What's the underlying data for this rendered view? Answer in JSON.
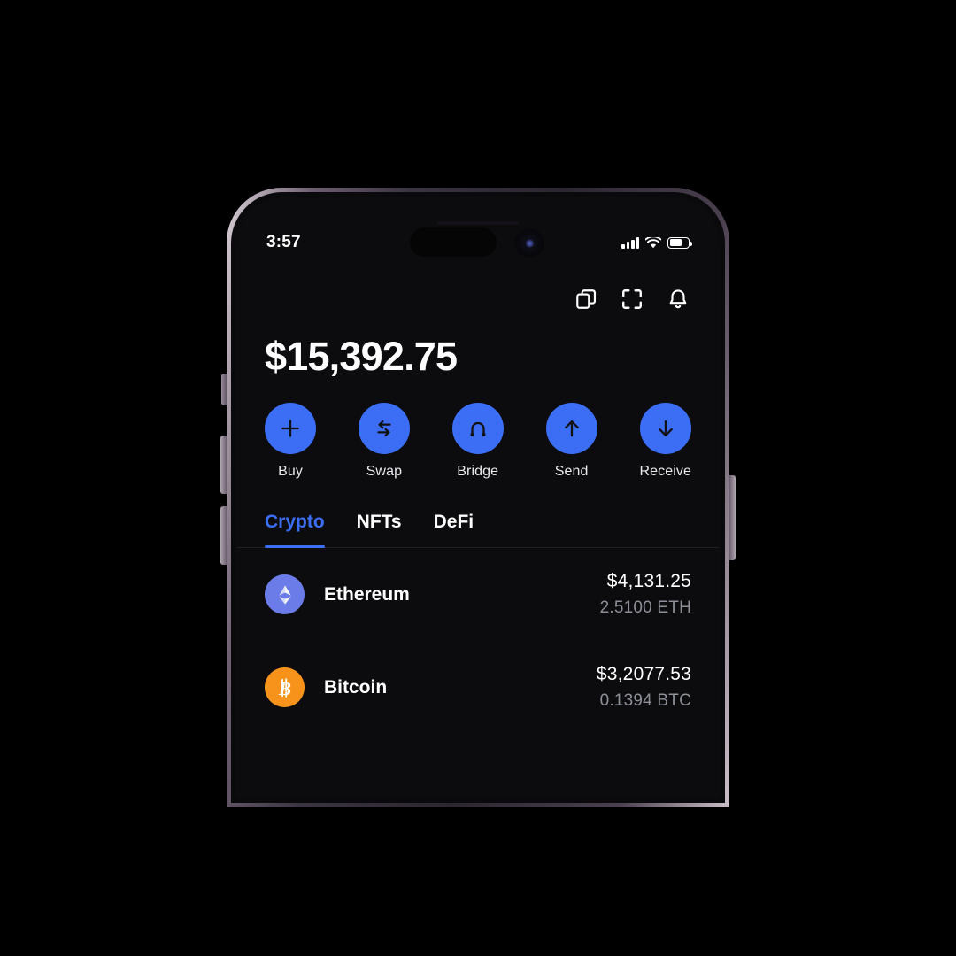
{
  "status_bar": {
    "time": "3:57",
    "signal_icon": "cellular-signal-icon",
    "wifi_icon": "wifi-icon",
    "battery_icon": "battery-icon",
    "battery_level_pct": 70
  },
  "header": {
    "actions": [
      {
        "name": "copy-icon",
        "label": "Copy"
      },
      {
        "name": "scan-icon",
        "label": "Scan"
      },
      {
        "name": "bell-icon",
        "label": "Notifications"
      }
    ]
  },
  "wallet": {
    "balance": "$15,392.75"
  },
  "quick_actions": [
    {
      "label": "Buy",
      "icon": "plus-icon"
    },
    {
      "label": "Swap",
      "icon": "swap-arrows-icon"
    },
    {
      "label": "Bridge",
      "icon": "bridge-icon"
    },
    {
      "label": "Send",
      "icon": "arrow-up-icon"
    },
    {
      "label": "Receive",
      "icon": "arrow-down-icon"
    }
  ],
  "tabs": [
    {
      "label": "Crypto",
      "active": true
    },
    {
      "label": "NFTs",
      "active": false
    },
    {
      "label": "DeFi",
      "active": false
    }
  ],
  "tokens": [
    {
      "name": "Ethereum",
      "value": "$4,131.25",
      "amount": "2.5100 ETH",
      "icon": "ethereum-icon",
      "icon_color": "#6b7ce8"
    },
    {
      "name": "Bitcoin",
      "value": "$3,2077.53",
      "amount": "0.1394 BTC",
      "icon": "bitcoin-icon",
      "icon_color": "#f7931a"
    }
  ],
  "colors": {
    "accent": "#3b6ef5",
    "background": "#0c0c0e",
    "text_primary": "#ffffff",
    "text_secondary": "#8e9099"
  }
}
